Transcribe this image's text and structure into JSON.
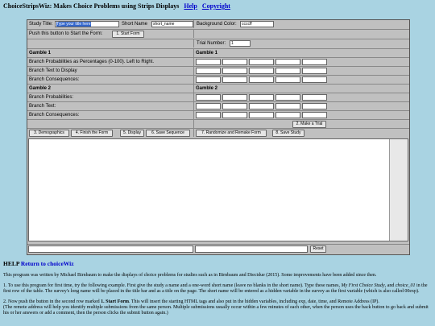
{
  "header": {
    "title": "ChoiceStripsWiz: Makes Choice Problems using Strips Displays",
    "help_link": "Help",
    "copyright_link": "Copyright"
  },
  "form": {
    "study_title_label": "Study Title:",
    "study_title_value": "Type your title here",
    "short_name_label": "Short Name",
    "short_name_value": "short_name",
    "bg_color_label": "Background Color:",
    "bg_color_value": "ccccff",
    "push_label": "Push this button to Start the Form:",
    "start_button": "1. Start Form",
    "trial_number_label": "Trial Number:",
    "trial_number_value": "1",
    "gamble1_label": "Gamble 1",
    "gamble1_right": "Gamble 1",
    "branch_prob_pct": "Branch Probabilities as Percentages (0-100). Left to Right.",
    "branch_text_display": "Branch Text to Display",
    "branch_consequences": "Branch Consequences:",
    "gamble2_label": "Gamble 2",
    "gamble2_right": "Gamble 2",
    "branch_probabilities": "Branch Probabilities:",
    "branch_text": "Branch Text:",
    "branch_consequences2": "Branch Consequences:",
    "make_trial_button": "2. Make a Trial",
    "reset_button": "Reset"
  },
  "buttons": [
    "3. Demographics",
    "4. Finish the Form",
    "5. Display",
    "6. Save Sequence",
    "7. Randomize and Remake Form",
    "8. Save Study"
  ],
  "help": {
    "heading": "HELP",
    "return_link": "Return to choiceWiz",
    "p1": "This program was written by Michael Birnbaum to make the displays of choice problems for studies such as in Birnbaum and Diecidue (2015). Some improvements have been added since then.",
    "p2a": "1. To use this program for first time, try the following example. First give the study a name and a one-word short name (leave no blanks in the short name). Type these names,",
    "p2b": "My First Choice Study",
    "p2c": ", and",
    "p2d": "choice_01",
    "p2e": "in the first row of the table. The survey's long name will be placed in the title bar and as a title on the page. The short name will be entered as a hidden variable in the survey as the first variable (which is also called 00exp).",
    "p3a": "2. Now push the button in the second row marked",
    "p3b": "1. Start Form",
    "p3c": ". This will insert the starting HTML tags and also put in the hidden variables, including exp, date, time, and Remote Address (IP).",
    "p4": "(The remote address will help you identify multiple submissions from the same person. Multiple submissions usually occur within a few minutes of each other, when the person uses the back button to go back and submit his or her answers or add a comment, then the person clicks the submit button again.)"
  }
}
